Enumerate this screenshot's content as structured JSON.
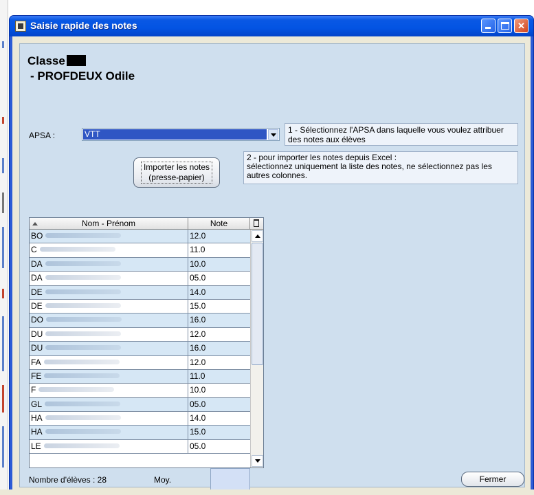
{
  "window": {
    "title": "Saisie rapide des notes",
    "min_label": "",
    "max_label": "",
    "close_label": "✕"
  },
  "header": {
    "classe_label": "Classe",
    "prof_line": " - PROFDEUX Odile"
  },
  "apsa": {
    "label": "APSA :",
    "selected": "VTT",
    "hint": "1 - Sélectionnez l'APSA dans laquelle vous voulez attribuer des notes aux élèves"
  },
  "import": {
    "button_line1": "Importer les notes",
    "button_line2": "(presse-papier)",
    "hint_line1": "2 - pour importer les notes depuis Excel :",
    "hint_line2": "sélectionnez uniquement la liste des notes, ne sélectionnez pas les autres colonnes."
  },
  "grid": {
    "col_name": "Nom - Prénom",
    "col_note": "Note",
    "rows": [
      {
        "name": "BO",
        "note": "12.0"
      },
      {
        "name": "C",
        "note": "11.0"
      },
      {
        "name": "DA",
        "note": "10.0"
      },
      {
        "name": "DA",
        "note": "05.0"
      },
      {
        "name": "DE",
        "note": "14.0"
      },
      {
        "name": "DE",
        "note": "15.0"
      },
      {
        "name": "DO",
        "note": "16.0"
      },
      {
        "name": "DU",
        "note": "12.0"
      },
      {
        "name": "DU",
        "note": "16.0"
      },
      {
        "name": "FA",
        "note": "12.0"
      },
      {
        "name": "FE",
        "note": "11.0"
      },
      {
        "name": "F",
        "note": "10.0"
      },
      {
        "name": "GL",
        "note": "05.0"
      },
      {
        "name": "HA",
        "note": "14.0"
      },
      {
        "name": "HA",
        "note": "15.0"
      },
      {
        "name": "LE",
        "note": "05.0"
      }
    ]
  },
  "footer": {
    "count": "Nombre d'élèves : 28",
    "moy_label": "Moy.",
    "moy_value": "",
    "close_button": "Fermer"
  },
  "colors": {
    "titlebar": "#0354e3",
    "panel": "#cfdfee",
    "row_alt": "#d6e7f5"
  }
}
